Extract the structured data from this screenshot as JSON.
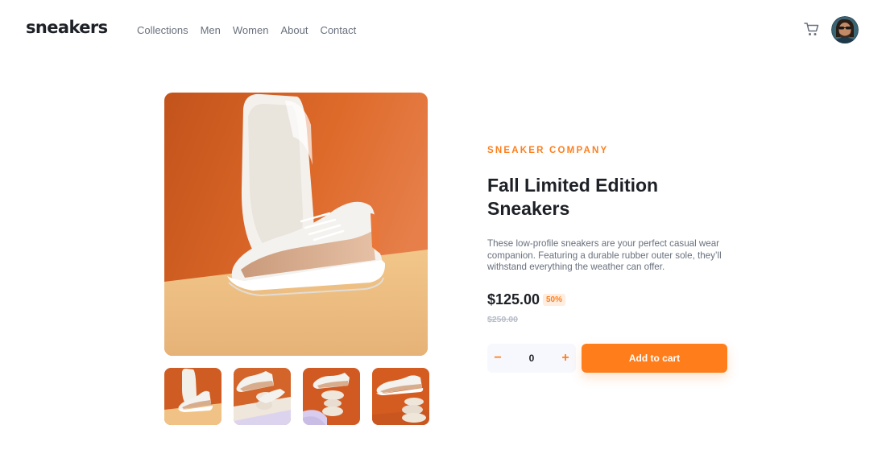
{
  "header": {
    "logo": "sneakers",
    "nav": [
      "Collections",
      "Men",
      "Women",
      "About",
      "Contact"
    ],
    "cart_icon": "cart-icon",
    "avatar_icon": "avatar"
  },
  "gallery": {
    "main_image": "sneaker-main-image",
    "thumbnails": [
      "thumbnail-1",
      "thumbnail-2",
      "thumbnail-3",
      "thumbnail-4"
    ]
  },
  "product": {
    "company": "Sneaker Company",
    "title": "Fall Limited Edition Sneakers",
    "description": "These low-profile sneakers are your perfect casual wear companion. Featuring a durable rubber outer sole, they’ll withstand everything the weather can offer.",
    "price": "$125.00",
    "discount": "50%",
    "original_price": "$250.00"
  },
  "quantity": {
    "minus": "−",
    "value": "0",
    "plus": "+"
  },
  "add_to_cart": "Add to cart",
  "colors": {
    "accent": "#ff7e1b",
    "accent_pale": "#ffede0",
    "dark": "#1d2026",
    "grey": "#69707d"
  }
}
